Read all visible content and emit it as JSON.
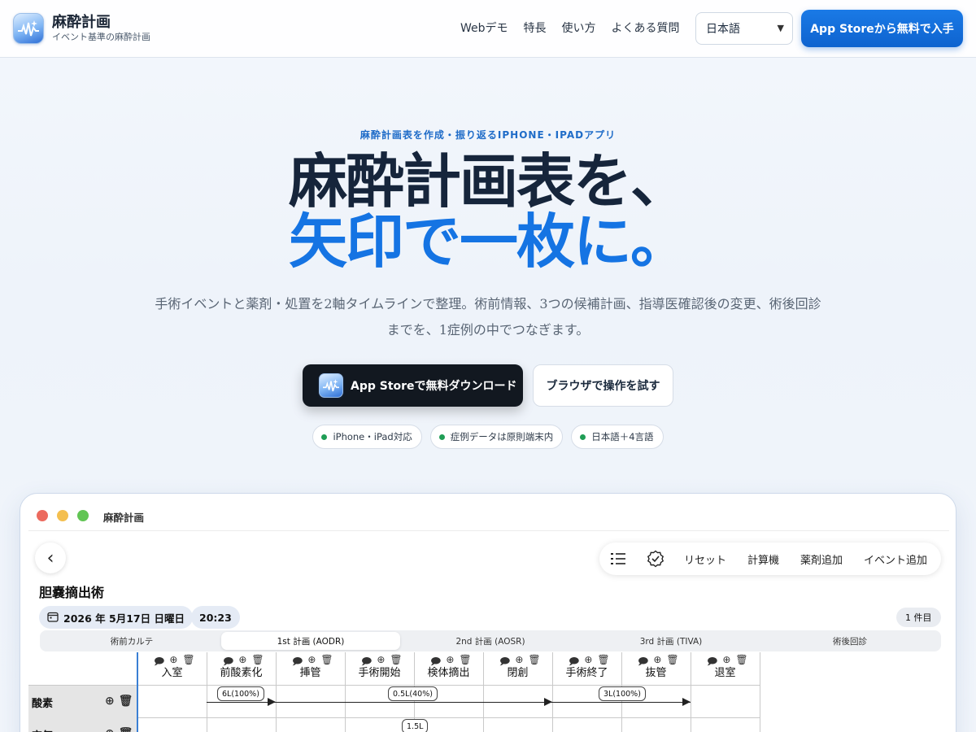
{
  "header": {
    "brand_name": "麻酔計画",
    "brand_tagline": "イベント基準の麻酔計画",
    "nav": [
      "Webデモ",
      "特長",
      "使い方",
      "よくある質問"
    ],
    "language": "日本語",
    "cta": "App Storeから無料で入手"
  },
  "hero": {
    "eyebrow": "麻酔計画表を作成・振り返るIPHONE・IPADアプリ",
    "title_line1": "麻酔計画表を、",
    "title_line2": "矢印で一枚に。",
    "description": "手術イベントと薬剤・処置を2軸タイムラインで整理。術前情報、3つの候補計画、指導医確認後の変更、術後回診までを、1症例の中でつなぎます。",
    "primary_button": "App Storeで無料ダウンロード",
    "secondary_button": "ブラウザで操作を試す",
    "chips": [
      "iPhone・iPad対応",
      "症例データは原則端末内",
      "日本語＋4言語"
    ]
  },
  "mock": {
    "window_title": "麻酔計画",
    "toolbar": [
      "リセット",
      "計算機",
      "薬剤追加",
      "イベント追加"
    ],
    "case_title": "胆嚢摘出術",
    "date": "2026 年 5月17日 日曜日",
    "time": "20:23",
    "count": "1 件目",
    "tabs": [
      "術前カルテ",
      "1st 計画 (AODR)",
      "2nd 計画 (AOSR)",
      "3rd 計画 (TIVA)",
      "術後回診"
    ],
    "active_tab": 1,
    "events": [
      "入室",
      "前酸素化",
      "挿管",
      "手術開始",
      "検体摘出",
      "閉創",
      "手術終了",
      "抜管",
      "退室"
    ],
    "rows": [
      "酸素",
      "空気"
    ],
    "flows": [
      "6L(100%)",
      "0.5L(40%)",
      "3L(100%)",
      "1.5L"
    ]
  },
  "colors": {
    "accent": "#1574e3",
    "dark_button": "#121820",
    "status_dot": "#1f9d55"
  }
}
